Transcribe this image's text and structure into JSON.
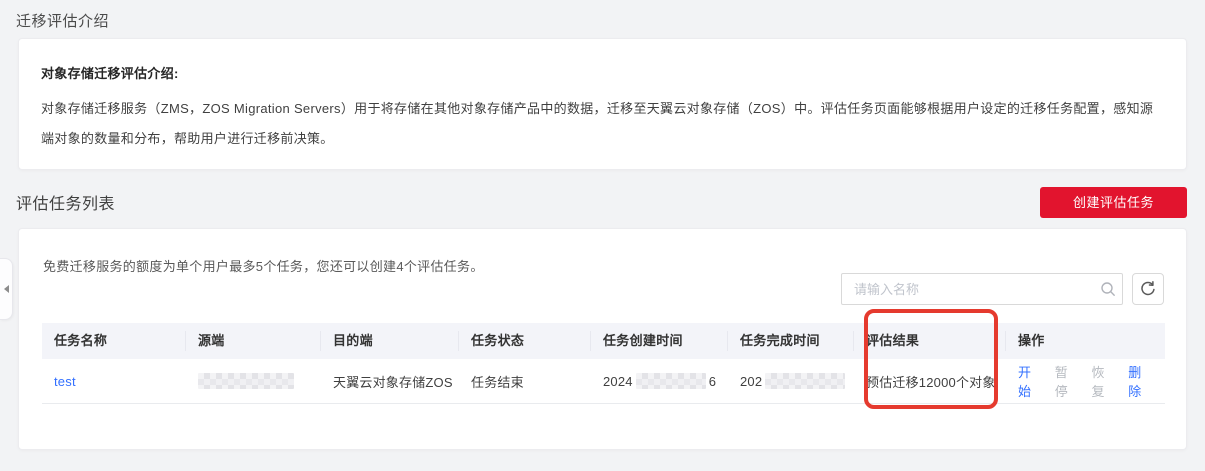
{
  "colors": {
    "brand_red": "#e2142e",
    "annotation_red": "#e53a2e",
    "link_blue": "#3370ff",
    "disabled_gray": "#b5b9bf"
  },
  "intro": {
    "page_title": "迁移评估介绍",
    "card_heading": "对象存储迁移评估介绍:",
    "card_body": "对象存储迁移服务（ZMS，ZOS Migration Servers）用于将存储在其他对象存储产品中的数据，迁移至天翼云对象存储（ZOS）中。评估任务页面能够根据用户设定的迁移任务配置，感知源端对象的数量和分布，帮助用户进行迁移前决策。"
  },
  "tasks": {
    "section_title": "评估任务列表",
    "create_button": "创建评估任务",
    "quota_note": "免费迁移服务的额度为单个用户最多5个任务，您还可以创建4个评估任务。",
    "search": {
      "placeholder": "请输入名称"
    },
    "columns": [
      "任务名称",
      "源端",
      "目的端",
      "任务状态",
      "任务创建时间",
      "任务完成时间",
      "评估结果",
      "操作"
    ],
    "row": {
      "name": "test",
      "source_redacted": true,
      "destination": "天翼云对象存储ZOS",
      "status": "任务结束",
      "created_prefix": "2024",
      "created_redacted": true,
      "created_suffix": "6",
      "completed_prefix": "202",
      "completed_redacted": true,
      "result": "预估迁移12000个对象",
      "actions": [
        {
          "label": "开始",
          "enabled": true
        },
        {
          "label": "暂停",
          "enabled": false
        },
        {
          "label": "恢复",
          "enabled": false
        },
        {
          "label": "删除",
          "enabled": true
        }
      ]
    }
  }
}
